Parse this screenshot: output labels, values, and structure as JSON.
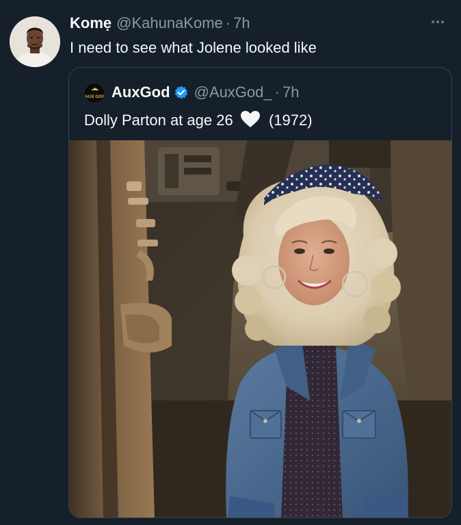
{
  "tweet": {
    "author_name": "Komẹ",
    "author_handle": "@KahunaKome",
    "separator": "·",
    "time": "7h",
    "text": "I need to see what Jolene looked like",
    "avatar_icon": "user-avatar",
    "more_icon": "more-options-icon"
  },
  "quoted_tweet": {
    "author_name": "AuxGod",
    "author_handle": "@AuxGod_",
    "separator": "·",
    "time": "7h",
    "text_before": "Dolly Parton at age 26",
    "emoji": "white-heart",
    "text_after": "(1972)",
    "avatar_logo_text": "AUX GOD",
    "verified_icon": "verified-badge-icon",
    "verified_color": "#1d9bf0",
    "media_type": "photo"
  },
  "colors": {
    "background": "#15202b",
    "primary_text": "#f7f9f9",
    "secondary_text": "#8b98a5",
    "border": "#38444d"
  }
}
